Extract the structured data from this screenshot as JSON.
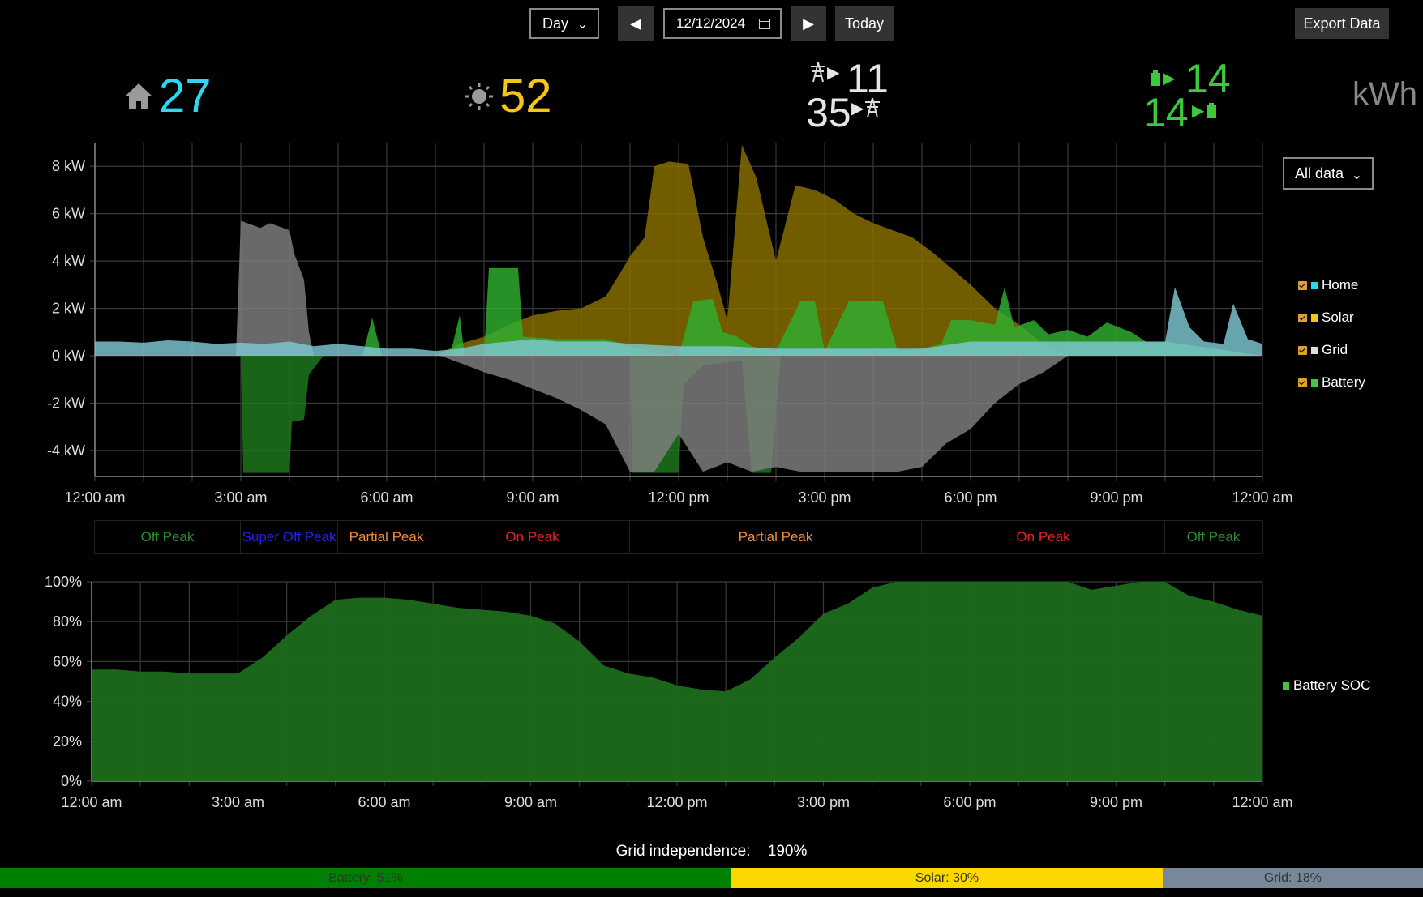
{
  "toolbar": {
    "period": "Day",
    "date": "12/12/2024",
    "today_label": "Today",
    "export_label": "Export Data"
  },
  "summary": {
    "home": "27",
    "solar": "52",
    "grid_import": "11",
    "grid_export": "35",
    "battery_charge": "14",
    "battery_discharge": "14",
    "unit": "kWh",
    "colors": {
      "home": "#2ed6f0",
      "solar": "#f5c518",
      "grid": "#e6e6e6",
      "battery": "#3ec83e"
    },
    "icons": {
      "home": "house-icon",
      "solar": "sun-icon",
      "grid": "power-tower-icon",
      "battery": "battery-icon"
    }
  },
  "filter": {
    "selected": "All data"
  },
  "legend": [
    {
      "label": "Home",
      "color": "#2ed6f0"
    },
    {
      "label": "Solar",
      "color": "#f5c518"
    },
    {
      "label": "Grid",
      "color": "#dddddd"
    },
    {
      "label": "Battery",
      "color": "#3ec83e"
    }
  ],
  "soc_legend": {
    "label": "Battery SOC",
    "color": "#3ec83e"
  },
  "rate_periods": [
    {
      "label": "Off Peak",
      "start": 0,
      "end": 3,
      "color": "#2e8b2e"
    },
    {
      "label": "Super Off Peak",
      "start": 3,
      "end": 5,
      "color": "#2323e6"
    },
    {
      "label": "Partial Peak",
      "start": 5,
      "end": 7,
      "color": "#f08c3c"
    },
    {
      "label": "On Peak",
      "start": 7,
      "end": 11,
      "color": "#e62323"
    },
    {
      "label": "Partial Peak",
      "start": 11,
      "end": 17,
      "color": "#f08c3c"
    },
    {
      "label": "On Peak",
      "start": 17,
      "end": 22,
      "color": "#e62323"
    },
    {
      "label": "Off Peak",
      "start": 22,
      "end": 24,
      "color": "#2e8b2e"
    }
  ],
  "grid_independence": {
    "label": "Grid independence:",
    "value": "190%"
  },
  "energy_mix": [
    {
      "label": "Battery: 51%",
      "share": 0.514,
      "color": "#008000"
    },
    {
      "label": "Solar: 30%",
      "share": 0.303,
      "color": "#ffd700"
    },
    {
      "label": "Grid: 18%",
      "share": 0.183,
      "color": "#778899"
    }
  ],
  "chart_data": [
    {
      "type": "area",
      "title": "",
      "xlabel": "",
      "ylabel": "",
      "x_ticks": [
        "12:00 am",
        "3:00 am",
        "6:00 am",
        "9:00 am",
        "12:00 pm",
        "3:00 pm",
        "6:00 pm",
        "9:00 pm",
        "12:00 am"
      ],
      "y_ticks": [
        "8 kW",
        "6 kW",
        "4 kW",
        "2 kW",
        "0 kW",
        "-2 kW",
        "-4 kW"
      ],
      "xlim": [
        0,
        24
      ],
      "ylim": [
        -5.1,
        9
      ],
      "grid": true,
      "legend_position": "right",
      "series": [
        {
          "name": "Solar",
          "color": "#8a7000",
          "points": [
            [
              0,
              0
            ],
            [
              7,
              0
            ],
            [
              7.5,
              0.5
            ],
            [
              8,
              0.8
            ],
            [
              8.5,
              1.3
            ],
            [
              9,
              1.7
            ],
            [
              9.5,
              1.9
            ],
            [
              10,
              2.0
            ],
            [
              10.5,
              2.5
            ],
            [
              10.8,
              3.5
            ],
            [
              11,
              4.2
            ],
            [
              11.3,
              5.0
            ],
            [
              11.5,
              8.0
            ],
            [
              11.8,
              8.2
            ],
            [
              12.2,
              8.1
            ],
            [
              12.5,
              5.0
            ],
            [
              12.8,
              3.0
            ],
            [
              13,
              1.5
            ],
            [
              13.3,
              8.9
            ],
            [
              13.6,
              7.5
            ],
            [
              14,
              4.0
            ],
            [
              14.4,
              7.2
            ],
            [
              14.8,
              7.0
            ],
            [
              15.2,
              6.6
            ],
            [
              15.6,
              6.0
            ],
            [
              16,
              5.6
            ],
            [
              16.4,
              5.3
            ],
            [
              16.8,
              5.0
            ],
            [
              17.2,
              4.4
            ],
            [
              17.6,
              3.7
            ],
            [
              18,
              3.0
            ],
            [
              18.5,
              2.0
            ],
            [
              19,
              1.3
            ],
            [
              19.5,
              0.5
            ],
            [
              20,
              0
            ],
            [
              24,
              0
            ]
          ]
        },
        {
          "name": "Battery",
          "color": "#2fb02f",
          "points": [
            [
              0,
              0
            ],
            [
              5.5,
              0
            ],
            [
              5.7,
              1.6
            ],
            [
              5.9,
              0
            ],
            [
              7.3,
              0
            ],
            [
              7.5,
              1.7
            ],
            [
              7.6,
              0
            ],
            [
              8,
              0
            ],
            [
              8.1,
              3.7
            ],
            [
              8.7,
              3.7
            ],
            [
              8.8,
              0.8
            ],
            [
              9.5,
              0.7
            ],
            [
              10.5,
              0.7
            ],
            [
              11,
              0.4
            ],
            [
              11.5,
              0.1
            ],
            [
              12,
              0
            ],
            [
              12.3,
              2.3
            ],
            [
              12.7,
              2.4
            ],
            [
              12.9,
              1.0
            ],
            [
              13.2,
              0.8
            ],
            [
              13.5,
              0.4
            ],
            [
              14,
              0.2
            ],
            [
              14.5,
              2.3
            ],
            [
              14.8,
              2.3
            ],
            [
              15,
              0.2
            ],
            [
              15.5,
              2.3
            ],
            [
              16.2,
              2.3
            ],
            [
              16.5,
              0.2
            ],
            [
              17,
              0.3
            ],
            [
              17.4,
              0.5
            ],
            [
              17.6,
              1.5
            ],
            [
              18,
              1.5
            ],
            [
              18.5,
              1.3
            ],
            [
              18.7,
              2.9
            ],
            [
              18.9,
              1.2
            ],
            [
              19.3,
              1.5
            ],
            [
              19.6,
              0.9
            ],
            [
              20,
              1.1
            ],
            [
              20.4,
              0.8
            ],
            [
              20.8,
              1.4
            ],
            [
              21.3,
              1.0
            ],
            [
              21.6,
              0.6
            ],
            [
              22,
              0.6
            ],
            [
              24,
              0
            ]
          ]
        },
        {
          "name": "Battery",
          "color": "#1f7a1f",
          "points": [
            [
              0,
              0
            ],
            [
              3,
              0
            ],
            [
              3.05,
              -4.95
            ],
            [
              4,
              -4.95
            ],
            [
              4.05,
              -2.8
            ],
            [
              4.3,
              -2.7
            ],
            [
              4.4,
              -0.8
            ],
            [
              4.7,
              0
            ],
            [
              11,
              0
            ],
            [
              11.05,
              -4.95
            ],
            [
              12,
              -4.95
            ],
            [
              12.1,
              -1.2
            ],
            [
              12.5,
              -0.4
            ],
            [
              13.3,
              -0.2
            ],
            [
              13.5,
              -4.95
            ],
            [
              13.9,
              -4.95
            ],
            [
              14.1,
              0
            ],
            [
              24,
              0
            ]
          ]
        },
        {
          "name": "Grid",
          "color": "#808080",
          "points": [
            [
              0,
              0
            ],
            [
              2.9,
              0
            ],
            [
              3,
              5.7
            ],
            [
              3.4,
              5.4
            ],
            [
              3.6,
              5.6
            ],
            [
              4,
              5.3
            ],
            [
              4.1,
              4.3
            ],
            [
              4.3,
              3.2
            ],
            [
              4.4,
              1.0
            ],
            [
              4.5,
              0
            ],
            [
              7.1,
              0
            ],
            [
              7.5,
              -0.3
            ],
            [
              8,
              -0.7
            ],
            [
              8.5,
              -1.0
            ],
            [
              9,
              -1.4
            ],
            [
              9.5,
              -1.8
            ],
            [
              10,
              -2.3
            ],
            [
              10.5,
              -2.9
            ],
            [
              11,
              -4.9
            ],
            [
              11.5,
              -4.9
            ],
            [
              12,
              -3.3
            ],
            [
              12.5,
              -4.9
            ],
            [
              13,
              -4.5
            ],
            [
              13.5,
              -4.9
            ],
            [
              14,
              -4.7
            ],
            [
              14.5,
              -4.9
            ],
            [
              15,
              -4.9
            ],
            [
              15.5,
              -4.9
            ],
            [
              16,
              -4.9
            ],
            [
              16.5,
              -4.9
            ],
            [
              17,
              -4.7
            ],
            [
              17.5,
              -3.7
            ],
            [
              18,
              -3.1
            ],
            [
              18.5,
              -2.0
            ],
            [
              19,
              -1.2
            ],
            [
              19.5,
              -0.7
            ],
            [
              20,
              0
            ],
            [
              24,
              0
            ]
          ]
        },
        {
          "name": "Home",
          "color": "#7ec8d3",
          "points": [
            [
              0,
              0.6
            ],
            [
              0.5,
              0.6
            ],
            [
              1,
              0.55
            ],
            [
              1.5,
              0.65
            ],
            [
              2,
              0.6
            ],
            [
              2.5,
              0.5
            ],
            [
              3,
              0.55
            ],
            [
              3.5,
              0.5
            ],
            [
              4,
              0.6
            ],
            [
              4.5,
              0.4
            ],
            [
              5,
              0.5
            ],
            [
              5.5,
              0.4
            ],
            [
              6,
              0.3
            ],
            [
              6.5,
              0.3
            ],
            [
              7,
              0.2
            ],
            [
              7.5,
              0.3
            ],
            [
              8,
              0.5
            ],
            [
              8.5,
              0.6
            ],
            [
              9,
              0.7
            ],
            [
              9.5,
              0.6
            ],
            [
              10,
              0.6
            ],
            [
              10.5,
              0.6
            ],
            [
              11,
              0.5
            ],
            [
              12,
              0.4
            ],
            [
              13,
              0.4
            ],
            [
              14,
              0.3
            ],
            [
              15,
              0.3
            ],
            [
              16,
              0.3
            ],
            [
              17,
              0.3
            ],
            [
              18,
              0.6
            ],
            [
              19,
              0.6
            ],
            [
              20,
              0.6
            ],
            [
              21,
              0.6
            ],
            [
              22,
              0.6
            ],
            [
              22.2,
              2.9
            ],
            [
              22.5,
              1.2
            ],
            [
              22.8,
              0.6
            ],
            [
              23.2,
              0.5
            ],
            [
              23.4,
              2.2
            ],
            [
              23.7,
              0.7
            ],
            [
              24,
              0.5
            ]
          ]
        }
      ]
    },
    {
      "type": "area",
      "title": "",
      "xlabel": "",
      "ylabel": "",
      "x_ticks": [
        "12:00 am",
        "3:00 am",
        "6:00 am",
        "9:00 am",
        "12:00 pm",
        "3:00 pm",
        "6:00 pm",
        "9:00 pm",
        "12:00 am"
      ],
      "y_ticks": [
        "100%",
        "80%",
        "60%",
        "40%",
        "20%",
        "0%"
      ],
      "xlim": [
        0,
        24
      ],
      "ylim": [
        0,
        100
      ],
      "grid": true,
      "legend_position": "right",
      "series": [
        {
          "name": "Battery SOC",
          "color": "#1e6b1e",
          "points": [
            [
              0,
              56
            ],
            [
              0.5,
              56
            ],
            [
              1,
              55
            ],
            [
              1.5,
              55
            ],
            [
              2,
              54
            ],
            [
              2.5,
              54
            ],
            [
              3,
              54
            ],
            [
              3.5,
              62
            ],
            [
              4,
              73
            ],
            [
              4.5,
              83
            ],
            [
              5,
              91
            ],
            [
              5.5,
              92
            ],
            [
              6,
              92
            ],
            [
              6.5,
              91
            ],
            [
              7,
              89
            ],
            [
              7.5,
              87
            ],
            [
              8,
              86
            ],
            [
              8.5,
              85
            ],
            [
              9,
              83
            ],
            [
              9.5,
              79
            ],
            [
              10,
              70
            ],
            [
              10.5,
              58
            ],
            [
              11,
              54
            ],
            [
              11.5,
              52
            ],
            [
              12,
              48
            ],
            [
              12.5,
              46
            ],
            [
              13,
              45
            ],
            [
              13.5,
              51
            ],
            [
              14,
              62
            ],
            [
              14.5,
              72
            ],
            [
              15,
              84
            ],
            [
              15.5,
              89
            ],
            [
              16,
              97
            ],
            [
              16.5,
              100
            ],
            [
              17,
              100
            ],
            [
              17.5,
              100
            ],
            [
              18,
              100
            ],
            [
              18.5,
              100
            ],
            [
              19,
              100
            ],
            [
              19.5,
              100
            ],
            [
              20,
              100
            ],
            [
              20.5,
              96
            ],
            [
              21,
              98
            ],
            [
              21.5,
              100
            ],
            [
              22,
              100
            ],
            [
              22.5,
              93
            ],
            [
              23,
              90
            ],
            [
              23.5,
              86
            ],
            [
              24,
              83
            ]
          ]
        }
      ]
    }
  ]
}
